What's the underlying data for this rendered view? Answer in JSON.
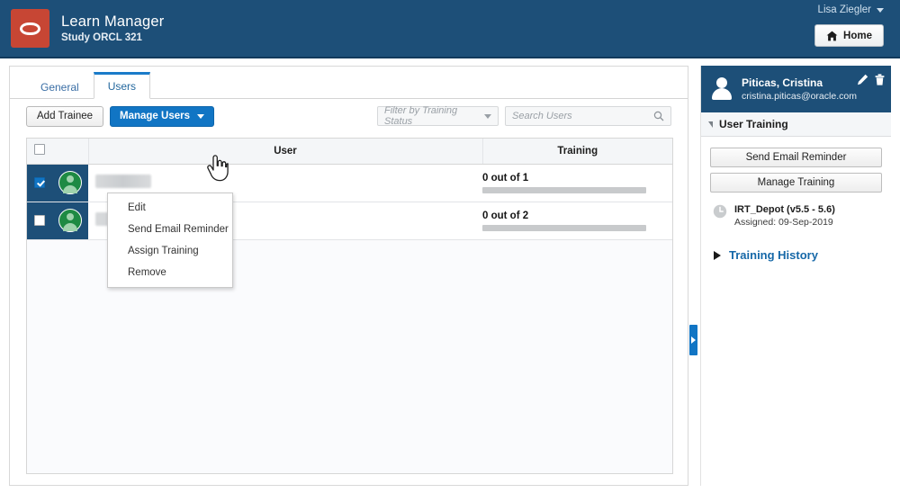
{
  "header": {
    "logo_icon": "oracle-logo-icon",
    "app_title": "Learn Manager",
    "study_subtitle": "Study ORCL 321",
    "user_name": "Lisa Ziegler",
    "home_button": "Home",
    "home_icon": "home-icon",
    "caret_icon": "chevron-down-icon"
  },
  "tabs": [
    {
      "label": "General",
      "active": false
    },
    {
      "label": "Users",
      "active": true
    }
  ],
  "toolbar": {
    "add_trainee_label": "Add Trainee",
    "manage_users_label": "Manage Users",
    "manage_users_caret": "chevron-down-icon",
    "filter_placeholder": "Filter by Training Status",
    "search_placeholder": "Search Users",
    "search_icon": "search-icon"
  },
  "dropdown_menu": {
    "open": true,
    "items": [
      {
        "label": "Edit"
      },
      {
        "label": "Send Email Reminder"
      },
      {
        "label": "Assign Training"
      },
      {
        "label": "Remove"
      }
    ]
  },
  "cursor": {
    "icon": "pointing-hand-cursor"
  },
  "table": {
    "columns": [
      {
        "key": "check",
        "label": ""
      },
      {
        "key": "avatar",
        "label": ""
      },
      {
        "key": "user",
        "label": "User"
      },
      {
        "key": "training",
        "label": "Training"
      }
    ],
    "header_checkbox_checked": false,
    "rows": [
      {
        "checked": true,
        "selected": true,
        "avatar_icon": "user-avatar-icon",
        "user_name_redacted": true,
        "user_name_width": 62,
        "training_label": "0 out of 1",
        "training_completed": 0,
        "training_total": 1,
        "progress_percent": 0
      },
      {
        "checked": false,
        "selected": false,
        "avatar_icon": "user-avatar-icon",
        "user_name_redacted": true,
        "user_name_width": 128,
        "training_label": "0 out of 2",
        "training_completed": 0,
        "training_total": 2,
        "progress_percent": 0
      }
    ]
  },
  "collapse_handle": {
    "icon": "chevron-right-icon"
  },
  "side_panel": {
    "avatar_icon": "user-avatar-icon",
    "person_name": "Piticas, Cristina",
    "person_email": "cristina.piticas@oracle.com",
    "edit_icon": "pencil-icon",
    "delete_icon": "trash-icon",
    "section_title": "User Training",
    "section_toggle_icon": "triangle-down-icon",
    "buttons": [
      {
        "label": "Send Email Reminder"
      },
      {
        "label": "Manage Training"
      }
    ],
    "training_items": [
      {
        "icon": "clock-icon",
        "name": "IRT_Depot (v5.5 - 5.6)",
        "assigned": "Assigned: 09-Sep-2019"
      }
    ],
    "history": {
      "label": "Training History",
      "toggle_icon": "triangle-right-icon"
    }
  },
  "colors": {
    "header_blue": "#1d4f78",
    "oracle_red": "#c74634",
    "primary_blue": "#1175c4",
    "link_blue": "#1668a8",
    "avatar_green": "#1e8a43",
    "row_selected": "#eaf2fa"
  }
}
